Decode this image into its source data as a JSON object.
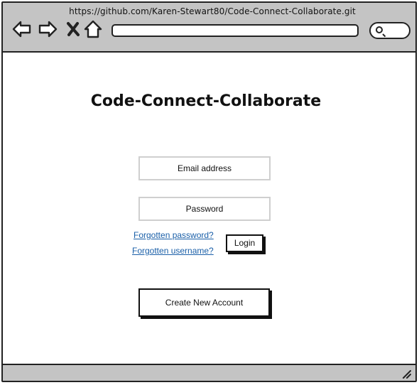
{
  "browser": {
    "url": "https://github.com/Karen-Stewart80/Code-Connect-Collaborate.git",
    "icons": [
      "back-arrow-icon",
      "forward-arrow-icon",
      "close-icon",
      "home-icon",
      "search-icon",
      "resize-grip-icon"
    ]
  },
  "page": {
    "title": "Code-Connect-Collaborate"
  },
  "login_form": {
    "email_placeholder": "Email address",
    "password_placeholder": "Password",
    "forgot_password_link": "Forgotten password?",
    "forgot_username_link": "Forgotten username?",
    "login_button": "Login"
  },
  "signup": {
    "create_account_button": "Create New Account"
  },
  "colors": {
    "chrome": "#c4c4c4",
    "link": "#1a5fa8",
    "border": "#222222"
  }
}
